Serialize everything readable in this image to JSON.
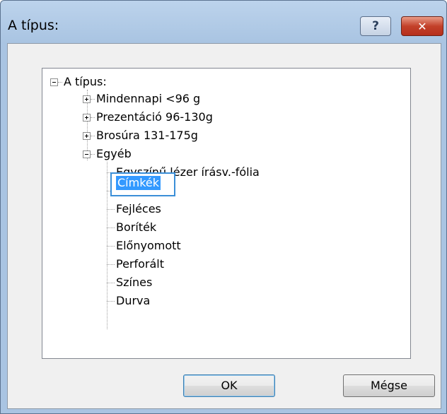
{
  "window": {
    "title": "A típus:"
  },
  "titlebar": {
    "help_label": "?",
    "close_label": "✕"
  },
  "tree": {
    "root": "A típus:",
    "items": [
      {
        "label": "Mindennapi <96 g"
      },
      {
        "label": "Prezentáció 96-130g"
      },
      {
        "label": "Brosúra 131-175g"
      },
      {
        "label": "Egyéb"
      }
    ],
    "egyeb_children": [
      {
        "label": "Egyszínű lézer írásv.-fólia"
      },
      {
        "label": "Címkék"
      },
      {
        "label": "Fejléces"
      },
      {
        "label": "Boríték"
      },
      {
        "label": "Előnyomott"
      },
      {
        "label": "Perforált"
      },
      {
        "label": "Színes"
      },
      {
        "label": "Durva"
      }
    ],
    "selected": "Címkék"
  },
  "buttons": {
    "ok_label": "OK",
    "cancel_label": "Mégse"
  }
}
